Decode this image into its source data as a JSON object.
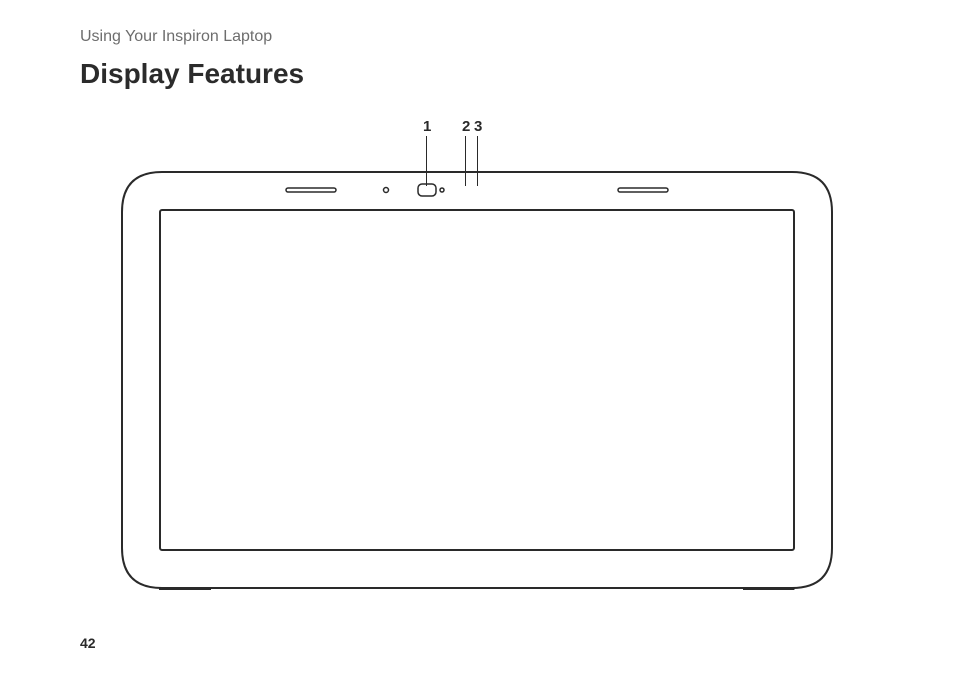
{
  "header": {
    "section": "Using Your Inspiron Laptop",
    "title": "Display Features"
  },
  "callouts": {
    "c1": "1",
    "c2": "2",
    "c3": "3"
  },
  "page_number": "42"
}
